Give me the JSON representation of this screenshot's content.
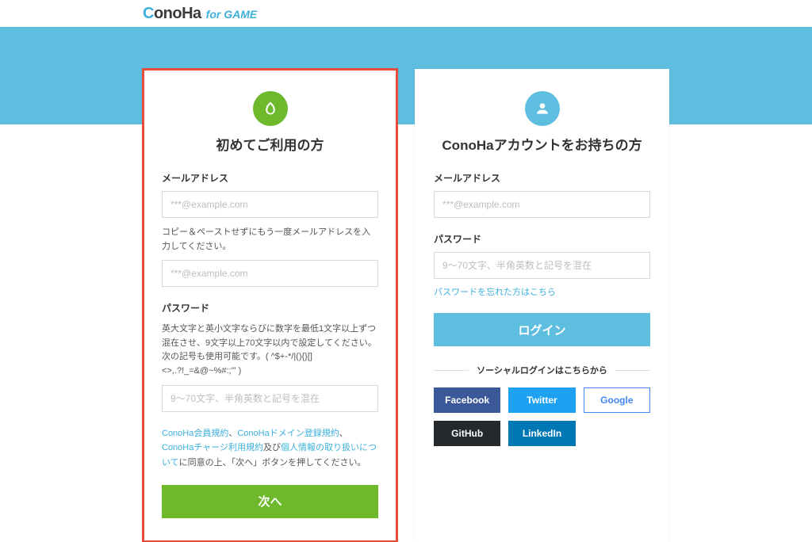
{
  "brand": {
    "name_c": "C",
    "name_rest": "onoHa",
    "suffix": "for GAME"
  },
  "signup": {
    "title": "初めてご利用の方",
    "email_label": "メールアドレス",
    "email_placeholder": "***@example.com",
    "email_confirm_hint": "コピー＆ペーストせずにもう一度メールアドレスを入力してください。",
    "email_confirm_placeholder": "***@example.com",
    "password_label": "パスワード",
    "password_hint": "英大文字と英小文字ならびに数字を最低1文字以上ずつ混在させ、9文字以上70文字以内で設定してください。\n次の記号も使用可能です。( ^$+-*/|(){}[]<>,.?!_=&@~%#:;'\" )",
    "password_placeholder": "9～70文字、半角英数と記号を混在",
    "terms_link1": "ConoHa会員規約",
    "terms_sep1": "、",
    "terms_link2": "ConoHaドメイン登録規約",
    "terms_sep2": "、",
    "terms_link3": "ConoHaチャージ利用規約",
    "terms_mid": "及び",
    "terms_link4": "個人情報の取り扱いについて",
    "terms_tail": "に同意の上、「次へ」ボタンを押してください。",
    "next_button": "次へ"
  },
  "login": {
    "title": "ConoHaアカウントをお持ちの方",
    "email_label": "メールアドレス",
    "email_placeholder": "***@example.com",
    "password_label": "パスワード",
    "password_placeholder": "9～70文字、半角英数と記号を混在",
    "forgot_link": "パスワードを忘れた方はこちら",
    "login_button": "ログイン",
    "social_heading": "ソーシャルログインはこちらから",
    "social": {
      "facebook": "Facebook",
      "twitter": "Twitter",
      "google": "Google",
      "github": "GitHub",
      "linkedin": "LinkedIn"
    }
  }
}
